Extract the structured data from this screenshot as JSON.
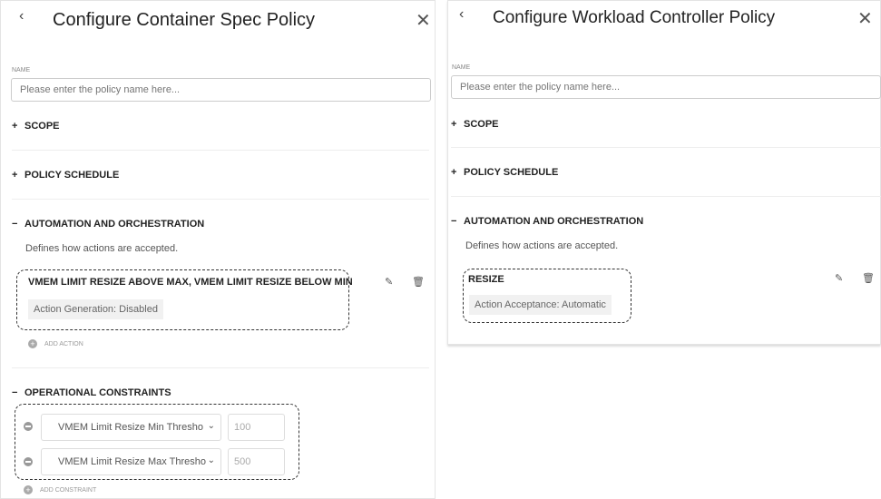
{
  "left": {
    "title": "Configure Container Spec Policy",
    "name_label": "NAME",
    "name_placeholder": "Please enter the policy name here...",
    "sections": {
      "scope": "SCOPE",
      "schedule": "POLICY SCHEDULE",
      "automation": "AUTOMATION AND ORCHESTRATION",
      "constraints": "OPERATIONAL CONSTRAINTS"
    },
    "automation_desc": "Defines how actions are accepted.",
    "action": {
      "title": "VMEM LIMIT RESIZE ABOVE MAX, VMEM LIMIT RESIZE BELOW MIN",
      "chip": "Action Generation: Disabled"
    },
    "add_action": "ADD ACTION",
    "constraints": [
      {
        "setting": "VMEM Limit Resize Min Thresho",
        "value": "100"
      },
      {
        "setting": "VMEM Limit Resize Max Thresho",
        "value": "500"
      }
    ],
    "add_constraint": "ADD CONSTRAINT"
  },
  "right": {
    "title": "Configure Workload Controller Policy",
    "name_label": "NAME",
    "name_placeholder": "Please enter the policy name here...",
    "sections": {
      "scope": "SCOPE",
      "schedule": "POLICY SCHEDULE",
      "automation": "AUTOMATION AND ORCHESTRATION"
    },
    "automation_desc": "Defines how actions are accepted.",
    "action": {
      "title": "RESIZE",
      "chip": "Action Acceptance: Automatic"
    }
  },
  "icons": {
    "back": "‹",
    "close": "✕",
    "plus": "+",
    "minus": "−",
    "edit": "✎",
    "delete": "🗑",
    "chevron": "⌄"
  }
}
